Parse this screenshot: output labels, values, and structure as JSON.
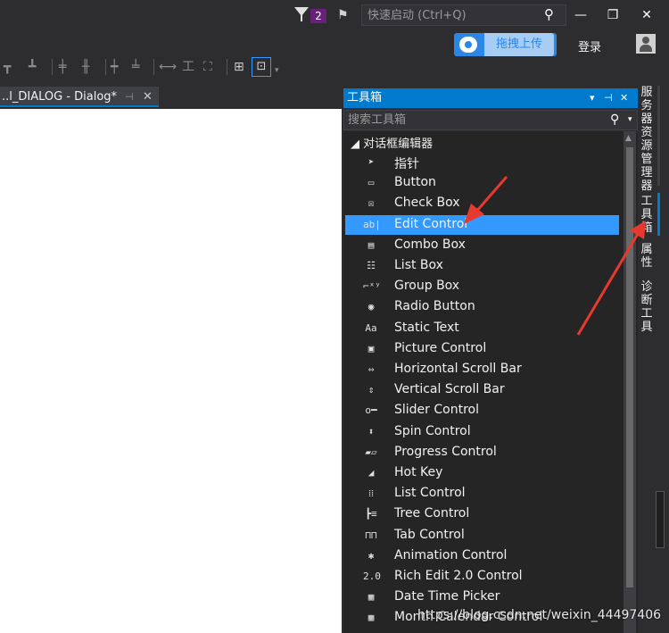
{
  "titlebar": {
    "notification_count": "2",
    "quick_launch_placeholder": "快速启动 (Ctrl+Q)",
    "minimize": "—",
    "restore": "❐",
    "close": "✕"
  },
  "header": {
    "upload_label": "拖拽上传",
    "login_label": "登录"
  },
  "document": {
    "tab_title": "..l_DIALOG - Dialog*",
    "pin": "⊣",
    "close": "✕"
  },
  "toolbox": {
    "title": "工具箱",
    "header_buttons": [
      "▾",
      "⊣",
      "✕"
    ],
    "search_placeholder": "搜索工具箱",
    "group_label": "◢ 对话框编辑器",
    "items": [
      {
        "label": "指针",
        "icon": "pointer-icon",
        "glyph": "➤"
      },
      {
        "label": "Button",
        "icon": "button-icon",
        "glyph": "▭"
      },
      {
        "label": "Check Box",
        "icon": "checkbox-icon",
        "glyph": "☒"
      },
      {
        "label": "Edit Control",
        "icon": "edit-control-icon",
        "glyph": "ab|"
      },
      {
        "label": "Combo Box",
        "icon": "combo-box-icon",
        "glyph": "▤"
      },
      {
        "label": "List Box",
        "icon": "list-box-icon",
        "glyph": "☷"
      },
      {
        "label": "Group Box",
        "icon": "group-box-icon",
        "glyph": "⌐ˣʸ"
      },
      {
        "label": "Radio Button",
        "icon": "radio-button-icon",
        "glyph": "◉"
      },
      {
        "label": "Static Text",
        "icon": "static-text-icon",
        "glyph": "Aa"
      },
      {
        "label": "Picture Control",
        "icon": "picture-control-icon",
        "glyph": "▣"
      },
      {
        "label": "Horizontal Scroll Bar",
        "icon": "hscroll-icon",
        "glyph": "⇔"
      },
      {
        "label": "Vertical Scroll Bar",
        "icon": "vscroll-icon",
        "glyph": "⇕"
      },
      {
        "label": "Slider Control",
        "icon": "slider-icon",
        "glyph": "o━"
      },
      {
        "label": "Spin Control",
        "icon": "spin-icon",
        "glyph": "⬍"
      },
      {
        "label": "Progress Control",
        "icon": "progress-icon",
        "glyph": "▰▱"
      },
      {
        "label": "Hot Key",
        "icon": "hot-key-icon",
        "glyph": "◢"
      },
      {
        "label": "List Control",
        "icon": "list-control-icon",
        "glyph": "⁞⁞"
      },
      {
        "label": "Tree Control",
        "icon": "tree-control-icon",
        "glyph": "┣≡"
      },
      {
        "label": "Tab Control",
        "icon": "tab-control-icon",
        "glyph": "⊓⊓"
      },
      {
        "label": "Animation Control",
        "icon": "animation-icon",
        "glyph": "✱"
      },
      {
        "label": "Rich Edit 2.0 Control",
        "icon": "rich-edit-icon",
        "glyph": "2.0"
      },
      {
        "label": "Date Time Picker",
        "icon": "date-time-icon",
        "glyph": "▦"
      },
      {
        "label": "Month Calendar Control",
        "icon": "month-calendar-icon",
        "glyph": "▦"
      }
    ],
    "selected_index": 3
  },
  "right_tabs": [
    {
      "label": "服务器资源管理器"
    },
    {
      "label": "工具箱",
      "active": true
    },
    {
      "label": "属性"
    },
    {
      "label": "诊断工具"
    }
  ],
  "watermark": "https://blog.csdn.net/weixin_44497406",
  "colors": {
    "accent": "#007acc",
    "selection": "#3399ff",
    "annotation": "#e8392e"
  }
}
